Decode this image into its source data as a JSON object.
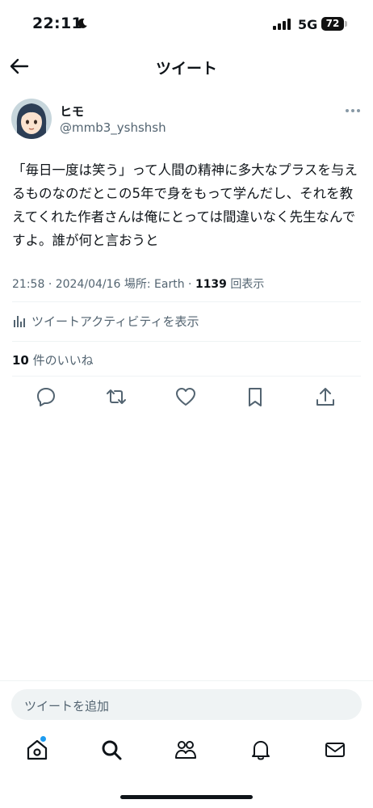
{
  "status": {
    "time": "22:11",
    "network": "5G",
    "battery": "72"
  },
  "header": {
    "title": "ツイート"
  },
  "author": {
    "display_name": "ヒモ",
    "handle": "@mmb3_yshshsh"
  },
  "tweet": {
    "text": "「毎日一度は笑う」って人間の精神に多大なプラスを与えるものなのだとこの5年で身をもって学んだし、それを教えてくれた作者さんは俺にとっては間違いなく先生なんですよ。誰が何と言おうと",
    "time": "21:58",
    "date": "2024/04/16",
    "location_label": "場所: Earth",
    "views": "1139",
    "views_label": "回表示"
  },
  "activity": {
    "label": "ツイートアクティビティを表示"
  },
  "likes": {
    "count": "10",
    "label": "件のいいね"
  },
  "reply": {
    "placeholder": "ツイートを追加"
  },
  "icons": {
    "back": "arrow-left-icon",
    "more": "more-horizontal-icon",
    "reply": "speech-bubble-icon",
    "retweet": "retweet-icon",
    "like": "heart-icon",
    "bookmark": "bookmark-icon",
    "share": "share-icon",
    "home": "home-icon",
    "search": "search-icon",
    "communities": "people-icon",
    "notifications": "bell-icon",
    "messages": "envelope-icon"
  },
  "colors": {
    "text": "#0f1419",
    "secondary": "#536471",
    "accent": "#1d9bf0",
    "divider": "#eff3f4"
  }
}
